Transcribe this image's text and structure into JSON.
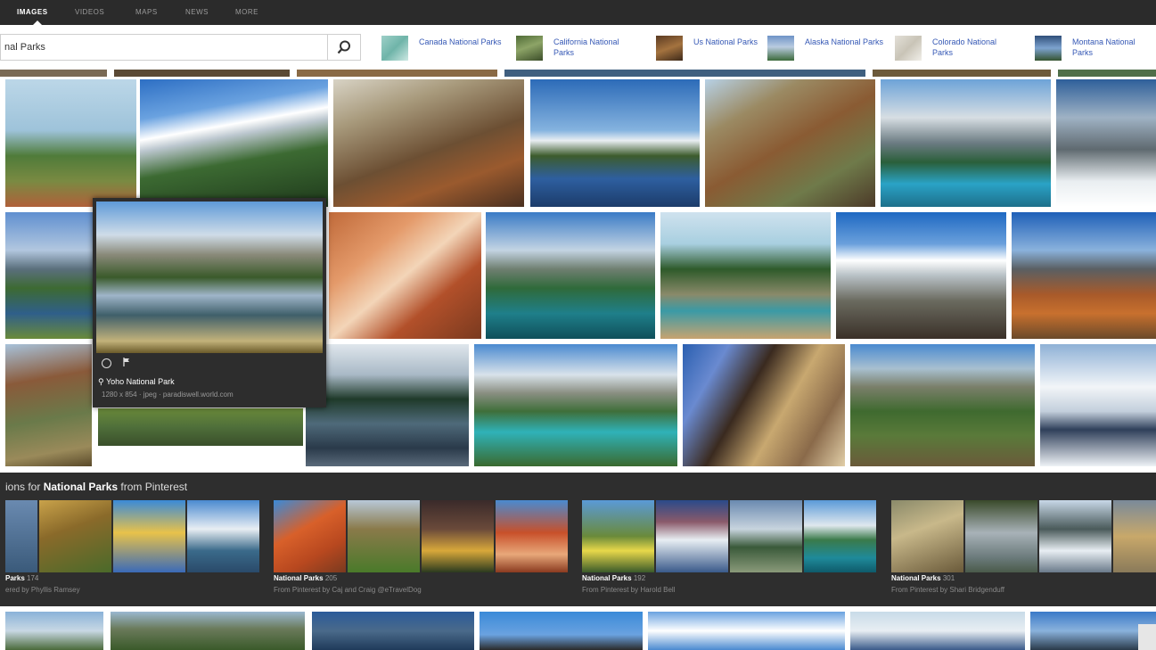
{
  "nav": {
    "tabs": [
      {
        "label": "IMAGES",
        "active": true
      },
      {
        "label": "VIDEOS",
        "active": false
      },
      {
        "label": "MAPS",
        "active": false
      },
      {
        "label": "NEWS",
        "active": false
      },
      {
        "label": "MORE",
        "active": false
      }
    ]
  },
  "search": {
    "value": "nal Parks",
    "button_icon": "search-icon"
  },
  "related_searches": [
    {
      "label": "Canada National Parks"
    },
    {
      "label": "California National Parks"
    },
    {
      "label": "Us National Parks"
    },
    {
      "label": "Alaska National Parks"
    },
    {
      "label": "Colorado National Parks"
    },
    {
      "label": "Montana National Parks"
    }
  ],
  "hover_card": {
    "action_icons": [
      "similar-images-icon",
      "flag-icon"
    ],
    "title": "Yoho National Park",
    "meta": "1280 x 854 · jpeg · paradiswell.world.com"
  },
  "pinterest": {
    "heading_prefix": "ions for ",
    "heading_query": "National Parks",
    "heading_suffix": " from Pinterest",
    "boards": [
      {
        "title": "Parks",
        "count": "174",
        "subtitle": "ered by Phyllis Ramsey"
      },
      {
        "title": "National Parks",
        "count": "205",
        "subtitle": "From Pinterest by Caj and Craig @eTravelDog"
      },
      {
        "title": "National Parks",
        "count": "192",
        "subtitle": "From Pinterest by Harold Bell"
      },
      {
        "title": "National Parks",
        "count": "301",
        "subtitle": "From Pinterest by Shari Bridgenduff"
      }
    ]
  },
  "colors": {
    "nav_bg": "#2b2b2b",
    "link": "#3558b5",
    "band_bg": "#2e2e2e"
  }
}
